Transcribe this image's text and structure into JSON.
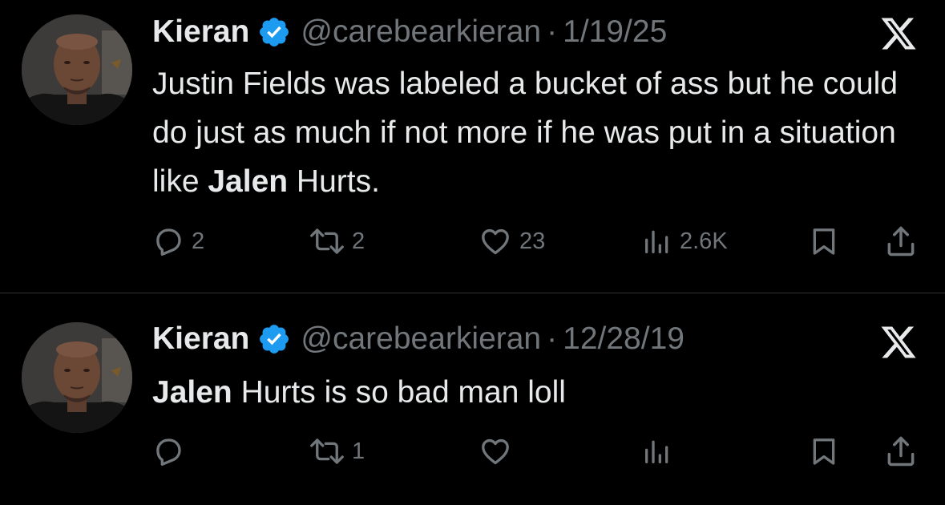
{
  "tweets": [
    {
      "author_name": "Kieran",
      "handle": "@carebearkieran",
      "separator": "·",
      "date": "1/19/25",
      "text_before": "Justin Fields was labeled a bucket of ass but he could do just as much if not more if he was put in a situation like ",
      "text_bold": "Jalen",
      "text_after": " Hurts.",
      "replies": "2",
      "reposts": "2",
      "likes": "23",
      "views": "2.6K"
    },
    {
      "author_name": "Kieran",
      "handle": "@carebearkieran",
      "separator": "·",
      "date": "12/28/19",
      "text_before": "",
      "text_bold": "Jalen",
      "text_after": " Hurts is so bad man loll",
      "replies": "",
      "reposts": "1",
      "likes": "",
      "views": ""
    }
  ],
  "colors": {
    "background": "#000000",
    "text_primary": "#e7e9ea",
    "text_secondary": "#71767b",
    "verified_blue": "#1d9bf0",
    "divider": "#2f3336"
  },
  "icons": [
    "verified-badge-icon",
    "x-logo-icon",
    "reply-icon",
    "repost-icon",
    "like-icon",
    "views-icon",
    "bookmark-icon",
    "share-icon"
  ]
}
